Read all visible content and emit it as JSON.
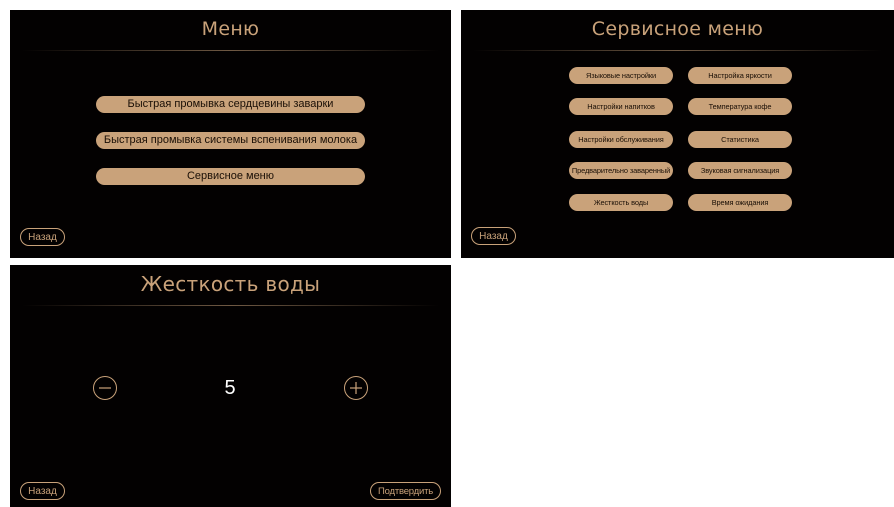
{
  "colors": {
    "accent": "#c9a27a",
    "background": "#030101",
    "value_text": "#ffffff"
  },
  "menu_screen": {
    "title": "Меню",
    "items": [
      {
        "label": "Быстрая промывка сердцевины заварки"
      },
      {
        "label": "Быстрая промывка системы вспенивания молока"
      },
      {
        "label": "Сервисное меню"
      }
    ],
    "back_label": "Назад"
  },
  "service_screen": {
    "title": "Сервисное меню",
    "items": [
      {
        "label": "Языковые настройки"
      },
      {
        "label": "Настройка яркости"
      },
      {
        "label": "Настройки напитков"
      },
      {
        "label": "Температура кофе"
      },
      {
        "label": "Настройки обслуживания"
      },
      {
        "label": "Статистика"
      },
      {
        "label": "Предварительно заваренный"
      },
      {
        "label": "Звуковая сигнализация"
      },
      {
        "label": "Жесткость воды"
      },
      {
        "label": "Время ожидания"
      }
    ],
    "back_label": "Назад"
  },
  "water_hardness_screen": {
    "title": "Жесткость воды",
    "value": "5",
    "decrease_icon": "minus-icon",
    "increase_icon": "plus-icon",
    "back_label": "Назад",
    "confirm_label": "Подтвердить"
  }
}
